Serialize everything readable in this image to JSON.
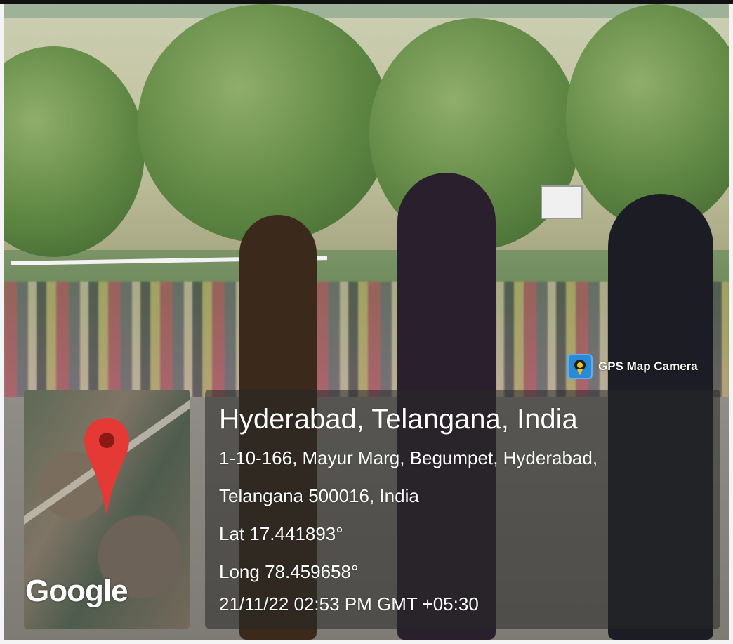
{
  "overlay": {
    "brand": {
      "label": "GPS Map Camera",
      "icon": "map-pin-camera-icon"
    },
    "location": {
      "title": "Hyderabad, Telangana, India",
      "address_line1": "1-10-166, Mayur Marg, Begumpet, Hyderabad,",
      "address_line2": "Telangana 500016, India",
      "lat": "Lat 17.441893°",
      "long": "Long 78.459658°",
      "datetime": "21/11/22 02:53 PM GMT +05:30"
    },
    "map": {
      "logo_text": "Google",
      "pin_icon": "map-pin-icon",
      "pin_color": "#e53935"
    }
  }
}
